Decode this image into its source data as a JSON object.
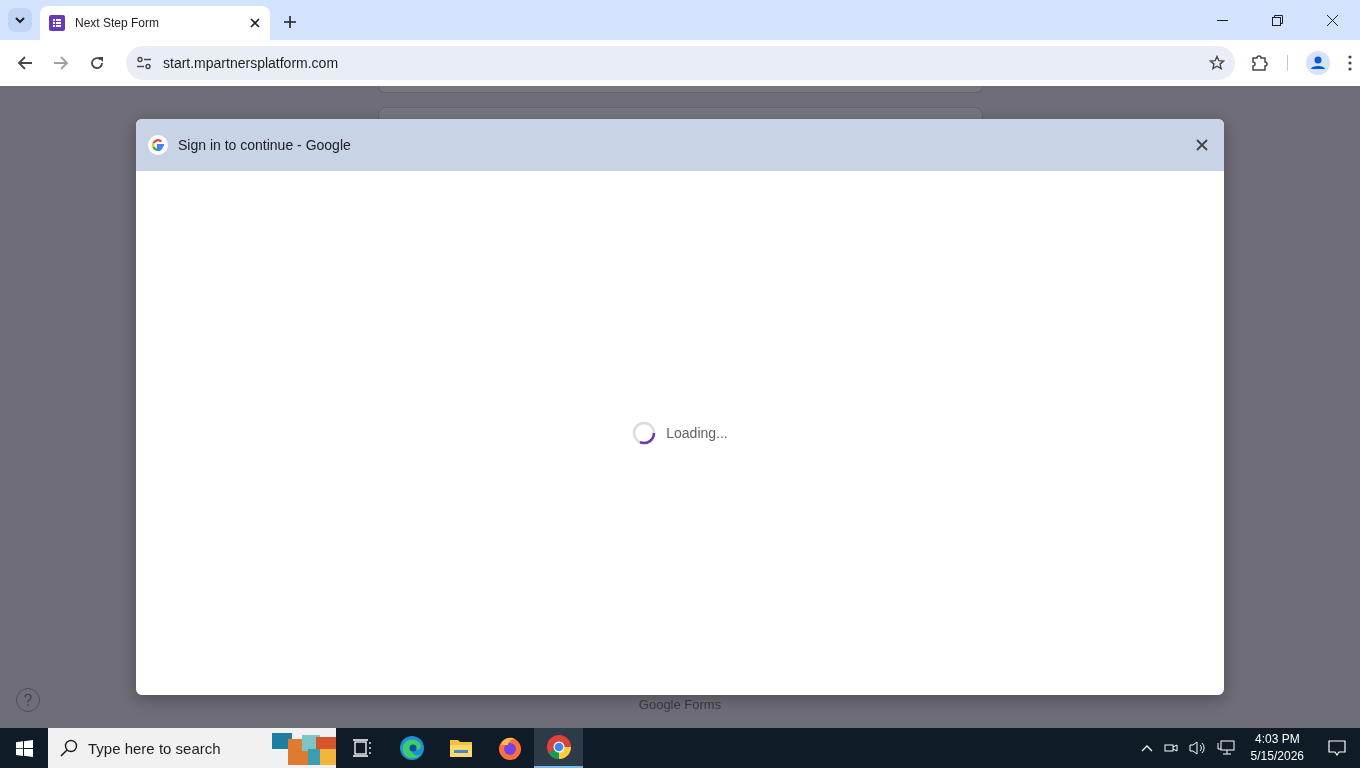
{
  "browser": {
    "tabs": [
      {
        "title": "Next Step Form",
        "selected": true
      }
    ],
    "address": "start.mpartnersplatform.com"
  },
  "dialog": {
    "title": "Sign in to continue - Google",
    "status": "Loading..."
  },
  "page": {
    "footer": "Google Forms"
  },
  "taskbar": {
    "search_placeholder": "Type here to search",
    "apps": [
      {
        "kind": "taskview",
        "selected": false
      },
      {
        "kind": "edge",
        "selected": false
      },
      {
        "kind": "files",
        "selected": false
      },
      {
        "kind": "firefox",
        "selected": false
      },
      {
        "kind": "chrome",
        "selected": true
      }
    ],
    "time": "4:03 PM",
    "date": "5/15/2026"
  }
}
